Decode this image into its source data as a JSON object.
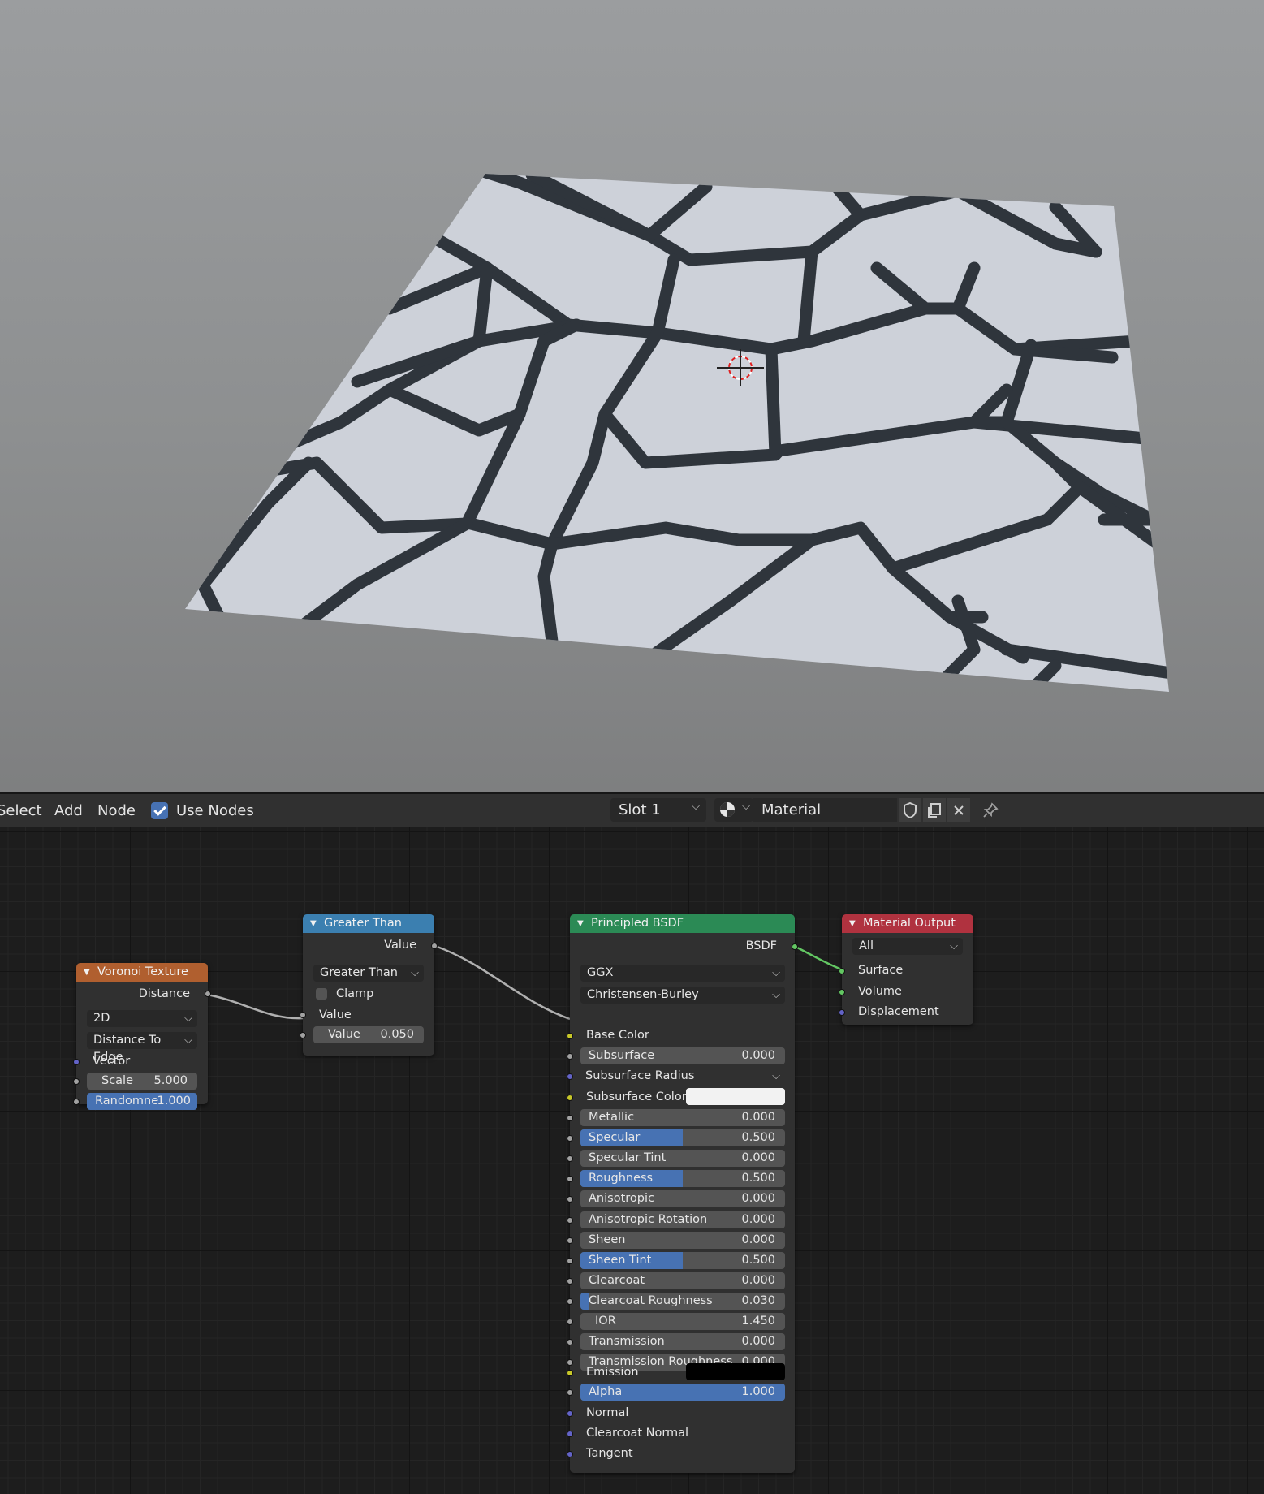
{
  "header": {
    "menus": [
      "Select",
      "Add",
      "Node"
    ],
    "use_nodes_label": "Use Nodes",
    "use_nodes_checked": true,
    "slot": "Slot 1",
    "material_name": "Material"
  },
  "nodes": {
    "voronoi": {
      "title": "Voronoi Texture",
      "color": "#b05f2f",
      "output": "Distance",
      "dimension": "2D",
      "feature": "Distance To Edge",
      "vector_label": "Vector",
      "scale_label": "Scale",
      "scale_value": "5.000",
      "randomness_label": "Randomne",
      "randomness_value": "1.000"
    },
    "greater_than": {
      "title": "Greater Than",
      "color": "#3b7fb0",
      "output": "Value",
      "operation": "Greater Than",
      "clamp_label": "Clamp",
      "input_label": "Value",
      "threshold_label": "Value",
      "threshold_value": "0.050"
    },
    "bsdf": {
      "title": "Principled BSDF",
      "color": "#2b8a55",
      "output": "BSDF",
      "distribution": "GGX",
      "subsurface_method": "Christensen-Burley",
      "base_color_label": "Base Color",
      "subsurface_radius_label": "Subsurface Radius",
      "subsurface_color_label": "Subsurface Color",
      "emission_label": "Emission",
      "fields": [
        {
          "label": "Subsurface",
          "value": "0.000",
          "fill": 0
        },
        {
          "label": "Metallic",
          "value": "0.000",
          "fill": 0
        },
        {
          "label": "Specular",
          "value": "0.500",
          "fill": 0.5
        },
        {
          "label": "Specular Tint",
          "value": "0.000",
          "fill": 0
        },
        {
          "label": "Roughness",
          "value": "0.500",
          "fill": 0.5
        },
        {
          "label": "Anisotropic",
          "value": "0.000",
          "fill": 0
        },
        {
          "label": "Anisotropic Rotation",
          "value": "0.000",
          "fill": 0
        },
        {
          "label": "Sheen",
          "value": "0.000",
          "fill": 0
        },
        {
          "label": "Sheen Tint",
          "value": "0.500",
          "fill": 0.5
        },
        {
          "label": "Clearcoat",
          "value": "0.000",
          "fill": 0
        },
        {
          "label": "Clearcoat Roughness",
          "value": "0.030",
          "fill": 0.03
        },
        {
          "label": "IOR",
          "value": "1.450",
          "fill": 0
        },
        {
          "label": "Transmission",
          "value": "0.000",
          "fill": 0
        },
        {
          "label": "Transmission Roughness",
          "value": "0.000",
          "fill": 0
        },
        {
          "label": "Alpha",
          "value": "1.000",
          "fill": 1
        }
      ],
      "normal_label": "Normal",
      "clearcoat_normal_label": "Clearcoat Normal",
      "tangent_label": "Tangent"
    },
    "output": {
      "title": "Material Output",
      "color": "#b0323f",
      "target": "All",
      "inputs": [
        "Surface",
        "Volume",
        "Displacement"
      ]
    }
  }
}
